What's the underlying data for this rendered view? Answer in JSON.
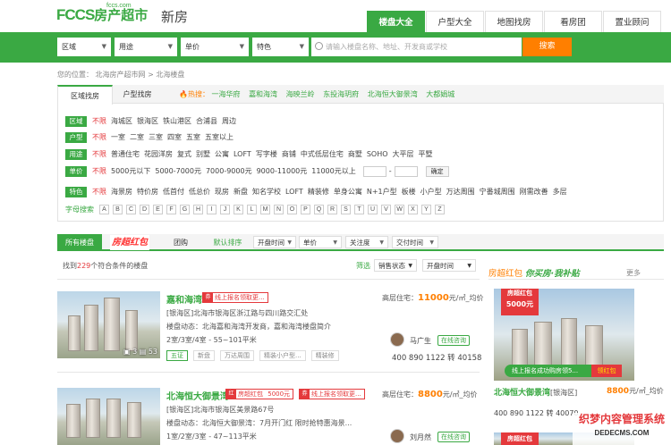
{
  "brand": {
    "logo": "FCCS",
    "logo_cn": "房产超市",
    "domain": "fccs.com",
    "section": "新房"
  },
  "nav": [
    "楼盘大全",
    "户型大全",
    "地图找房",
    "看房团",
    "置业顾问"
  ],
  "search": {
    "region": "区域",
    "usage": "用途",
    "price": "单价",
    "feature": "特色",
    "placeholder": "请输入楼盘名称、地址、开发商或学校",
    "button": "搜索"
  },
  "breadcrumb": "您的位置： 北海房产超市网 > 北海楼盘",
  "filter_tabs": [
    "区域找房",
    "户型找房"
  ],
  "hot": {
    "label": "热搜：",
    "items": [
      "一海华府",
      "嘉和海湾",
      "海映兰岭",
      "东投海玥府",
      "北海恒大御景湾",
      "大都娟城"
    ]
  },
  "filters": [
    {
      "tag": "区域",
      "opts": [
        "不限",
        "海城区",
        "银海区",
        "铁山港区",
        "合浦县",
        "周边"
      ]
    },
    {
      "tag": "户型",
      "opts": [
        "不限",
        "一室",
        "二室",
        "三室",
        "四室",
        "五室",
        "五室以上"
      ]
    },
    {
      "tag": "用途",
      "opts": [
        "不限",
        "普通住宅",
        "花园洋房",
        "复式",
        "别墅",
        "公寓",
        "LOFT",
        "写字楼",
        "商铺",
        "中式低层住宅",
        "商墅",
        "SOHO",
        "大平层",
        "平墅"
      ]
    },
    {
      "tag": "单价",
      "opts": [
        "不限",
        "5000元以下",
        "5000-7000元",
        "7000-9000元",
        "9000-11000元",
        "11000元以上"
      ],
      "ok": "确定"
    },
    {
      "tag": "特色",
      "opts": [
        "不限",
        "海景房",
        "特价房",
        "低首付",
        "低总价",
        "现房",
        "新盘",
        "知名学校",
        "LOFT",
        "精装修",
        "单身公寓",
        "N+1户型",
        "板楼",
        "小户型",
        "万达周围",
        "宁番城周围",
        "刚需改善",
        "多层"
      ]
    }
  ],
  "letters_label": "字母搜索",
  "letters": [
    "A",
    "B",
    "C",
    "D",
    "E",
    "F",
    "G",
    "H",
    "I",
    "J",
    "K",
    "L",
    "M",
    "N",
    "O",
    "P",
    "Q",
    "R",
    "S",
    "T",
    "U",
    "V",
    "W",
    "X",
    "Y",
    "Z"
  ],
  "sort": {
    "all": "所有楼盘",
    "hongbao": "房超红包",
    "group": "团购",
    "default": "默认排序",
    "open": "开盘时间",
    "price": "单价",
    "attention": "关注度",
    "delivery": "交付时间"
  },
  "found": {
    "pre": "找到",
    "count": "229",
    "post": "个符合条件的楼盘",
    "filter": "筛选",
    "status": "销售状态",
    "open": "开盘时间"
  },
  "listings": [
    {
      "name": "嘉和海湾",
      "badge": "线上报名领取更...",
      "addr": "[银海区]北海市银海区浙江路与四川路交汇处",
      "news": "楼盘动态：北海嘉和海湾开发商，嘉和海湾楼盘简介",
      "type": "2室/3室/4室 - 55~101平米",
      "tags": [
        "五证",
        "新盘",
        "万达周围",
        "精装小户型...",
        "精装修"
      ],
      "price_label": "高层住宅：",
      "price": "11000",
      "unit": "元/㎡_均价",
      "agent": "马广生",
      "consult": "在线咨询",
      "phone": "400 890 1122 转 40158",
      "photo": "3",
      "video": "53"
    },
    {
      "name": "北海恒大御景湾",
      "badge": "房超红包",
      "badge_amt": "5000元",
      "badge2": "线上报名领取更...",
      "addr": "[银海区]北海市银海区美景路67号",
      "news": "楼盘动态：北海恒大御景湾：7月开门红 限时抢特惠海景...",
      "type": "1室/2室/3室 - 47~113平米",
      "price_label": "高层住宅：",
      "price": "8800",
      "unit": "元/㎡_均价",
      "agent": "刘月然",
      "consult": "在线咨询"
    }
  ],
  "sidebar": {
    "title_a": "房超红包",
    "title_b": "你买房·我补贴",
    "more": "更多",
    "hb_title": "房超红包",
    "hb_amt": "5000元",
    "banner": "线上报名成功购房领5...",
    "pack": "领红包",
    "name": "北海恒大御景湾",
    "district": "[银海区]",
    "price": "8800",
    "unit": "元/㎡_均价",
    "phone": "400 890 1122 转 40070"
  },
  "watermark": {
    "cn": "织梦内容管理系统",
    "en": "DEDECMS.COM"
  },
  "colors": {
    "brand": "#3aa943",
    "accent": "#ff7f00",
    "red": "#e4393c"
  }
}
